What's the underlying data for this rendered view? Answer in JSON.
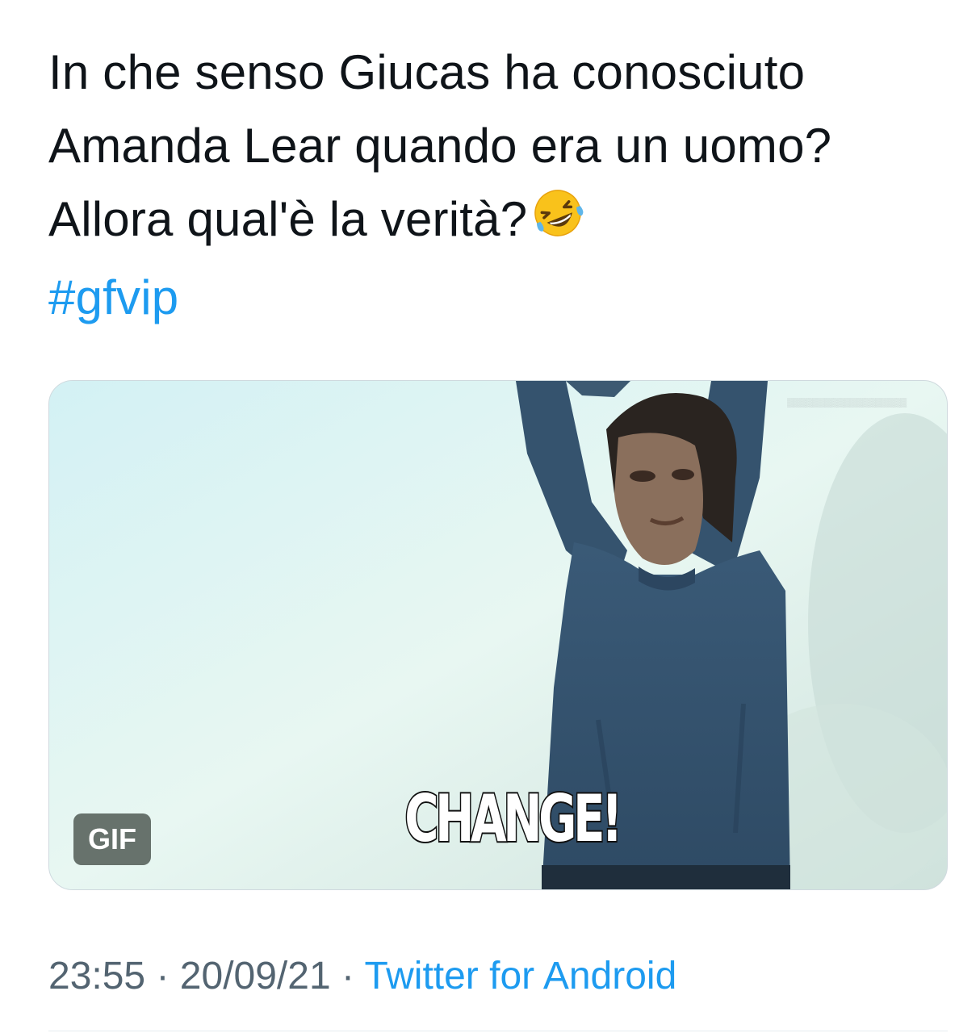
{
  "tweet": {
    "text_lines": [
      "In che senso Giucas ha conosciuto",
      "Amanda Lear quando era un uomo?",
      "Allora qual'è la verità?"
    ],
    "emoji": "rolling-on-the-floor-laughing",
    "hashtag": "#gfvip"
  },
  "media": {
    "caption": "CHANGE!",
    "badge": "GIF"
  },
  "meta": {
    "time": "23:55",
    "separator": "·",
    "date": "20/09/21",
    "source": "Twitter for Android"
  },
  "colors": {
    "text": "#0f1419",
    "link": "#1d9bf0",
    "meta": "#536471",
    "border": "#cfd9de"
  }
}
